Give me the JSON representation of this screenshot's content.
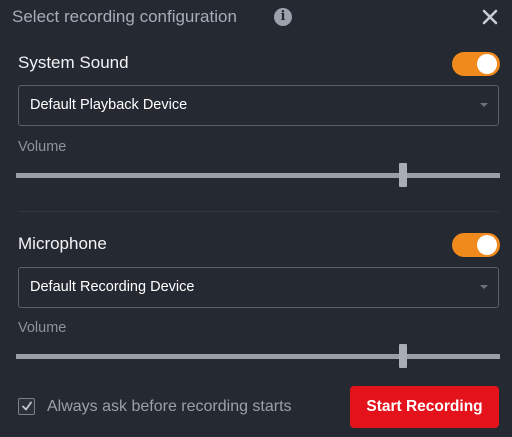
{
  "dialog": {
    "title": "Select recording configuration",
    "info_icon": "info-icon",
    "close_icon": "close-icon"
  },
  "system_sound": {
    "label": "System Sound",
    "enabled": true,
    "device": "Default Playback Device",
    "volume_label": "Volume",
    "volume": 0.8
  },
  "microphone": {
    "label": "Microphone",
    "enabled": true,
    "device": "Default Recording Device",
    "volume_label": "Volume",
    "volume": 0.8
  },
  "footer": {
    "checkbox_checked": true,
    "checkbox_label": "Always ask before recording starts",
    "start_button": "Start Recording"
  },
  "colors": {
    "background": "#252932",
    "toggle_on": "#f08a1c",
    "primary_button": "#e4131b"
  }
}
